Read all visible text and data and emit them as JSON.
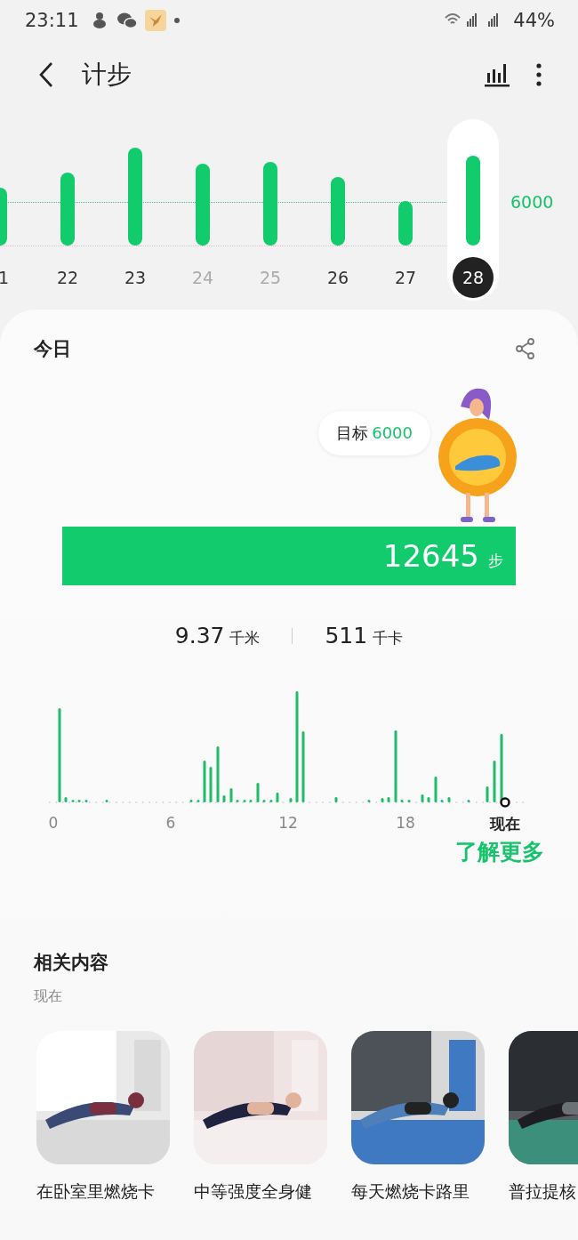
{
  "status_bar": {
    "time": "23:11",
    "battery": "44%"
  },
  "header": {
    "title": "计步"
  },
  "week": {
    "goal": "6000",
    "days": [
      {
        "label": "1",
        "selected": false,
        "dimmed": false
      },
      {
        "label": "22",
        "selected": false,
        "dimmed": false
      },
      {
        "label": "23",
        "selected": false,
        "dimmed": false
      },
      {
        "label": "24",
        "selected": false,
        "dimmed": true
      },
      {
        "label": "25",
        "selected": false,
        "dimmed": true
      },
      {
        "label": "26",
        "selected": false,
        "dimmed": false
      },
      {
        "label": "27",
        "selected": false,
        "dimmed": false
      },
      {
        "label": "28",
        "selected": true,
        "dimmed": false
      }
    ]
  },
  "today": {
    "title": "今日",
    "goal_label": "目标",
    "goal_value": "6000",
    "steps": "12645",
    "steps_unit": "步",
    "stats": [
      {
        "value": "9.37",
        "unit": "千米"
      },
      {
        "value": "511",
        "unit": "千卡"
      }
    ],
    "hour_ticks": [
      {
        "label": "0",
        "kind": "tick"
      },
      {
        "label": "6",
        "kind": "tick"
      },
      {
        "label": "12",
        "kind": "tick"
      },
      {
        "label": "18",
        "kind": "tick"
      },
      {
        "label": "现在",
        "kind": "now"
      }
    ],
    "more_link": "了解更多"
  },
  "related": {
    "title": "相关内容",
    "subtitle": "现在",
    "items": [
      {
        "title": "在卧室里燃烧卡"
      },
      {
        "title": "中等强度全身健"
      },
      {
        "title": "每天燃烧卡路里"
      },
      {
        "title": "普拉提核"
      }
    ]
  }
}
